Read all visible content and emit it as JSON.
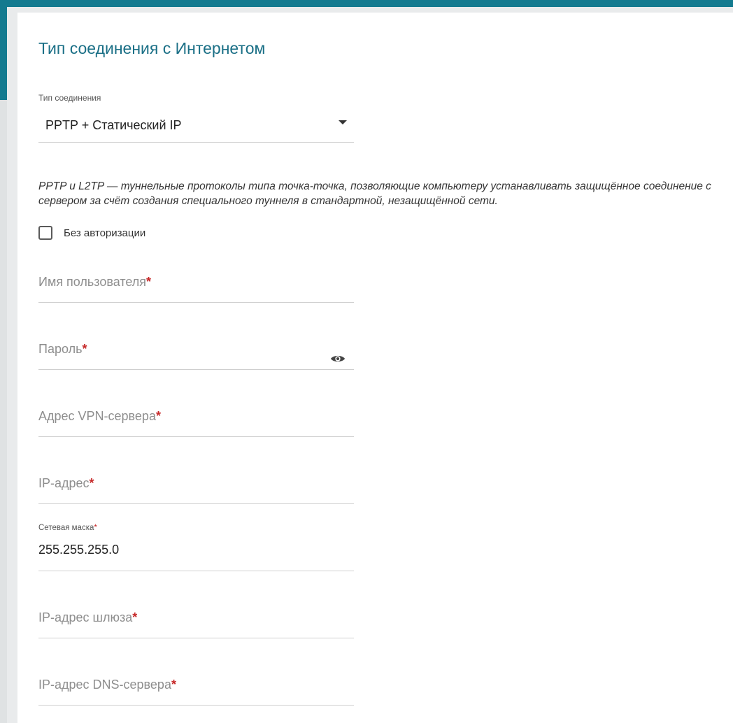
{
  "page": {
    "title": "Тип соединения с Интернетом"
  },
  "connection": {
    "label": "Тип соединения",
    "selected": "PPTP + Статический IP"
  },
  "description": "PPTP и L2TP — туннельные протоколы типа точка-точка, позволяющие компьютеру устанавливать защищённое соединение с сервером за счёт создания специального туннеля в стандартной, незащищённой сети.",
  "no_auth": {
    "label": "Без авторизации",
    "checked": false
  },
  "fields": {
    "username": {
      "placeholder": "Имя пользователя",
      "required_mark": "*"
    },
    "password": {
      "placeholder": "Пароль",
      "required_mark": "*",
      "icon": "eye-icon"
    },
    "vpn_server": {
      "placeholder": "Адрес VPN-сервера",
      "required_mark": "*"
    },
    "ip_address": {
      "placeholder": "IP-адрес",
      "required_mark": "*"
    },
    "netmask": {
      "label": "Сетевая маска",
      "required_mark": "*",
      "value": "255.255.255.0"
    },
    "gateway": {
      "placeholder": "IP-адрес шлюза",
      "required_mark": "*"
    },
    "dns": {
      "placeholder": "IP-адрес DNS-сервера",
      "required_mark": "*"
    }
  },
  "colors": {
    "accent": "#137a8f",
    "title": "#1a6f86",
    "required": "#c62828"
  }
}
